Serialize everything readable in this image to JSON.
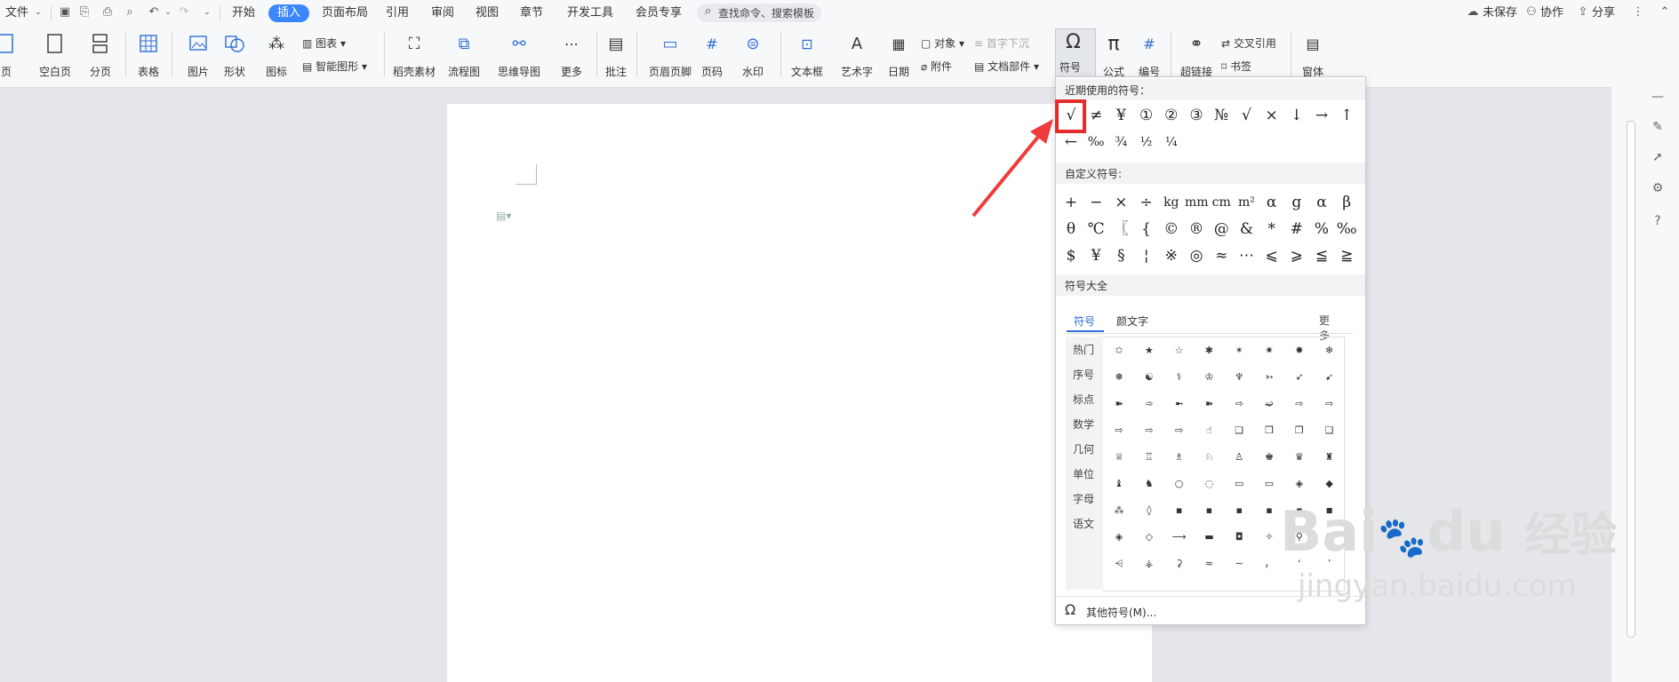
{
  "menubar": {
    "file": "文件",
    "tabs": [
      "开始",
      "插入",
      "页面布局",
      "引用",
      "审阅",
      "视图",
      "章节",
      "开发工具",
      "会员专享"
    ],
    "active_tab": "插入",
    "search_placeholder": "查找命令、搜索模板",
    "right": {
      "unsaved": "未保存",
      "collab": "协作",
      "share": "分享"
    }
  },
  "ribbon": {
    "buttons": [
      "页",
      "空白页",
      "分页",
      "表格",
      "图片",
      "形状",
      "图标",
      "稻壳素材",
      "流程图",
      "思维导图",
      "更多",
      "批注",
      "页眉页脚",
      "页码",
      "水印",
      "文本框",
      "艺术字",
      "日期",
      "符号",
      "公式",
      "编号",
      "超链接",
      "窗体"
    ],
    "small": {
      "chart": "图表",
      "smart": "智能图形",
      "object": "对象",
      "attachment": "附件",
      "dropcap": "首字下沉",
      "docpart": "文档部件",
      "crossref": "交叉引用",
      "bookmark": "书签"
    }
  },
  "symbol_panel": {
    "recent_title": "近期使用的符号：",
    "recent": [
      "√",
      "≠",
      "¥",
      "①",
      "②",
      "③",
      "№",
      "√",
      "×",
      "↓",
      "→",
      "↑",
      "←",
      "‰",
      "¾",
      "½",
      "¼"
    ],
    "custom_title": "自定义符号:",
    "custom": [
      "+",
      "−",
      "×",
      "÷",
      "kg",
      "mm",
      "cm",
      "m²",
      "α",
      "g",
      "α",
      "β",
      "θ",
      "℃",
      "〖",
      "{",
      "©",
      "®",
      "@",
      "&",
      "*",
      "#",
      "%",
      "‰",
      "$",
      "¥",
      "§",
      "¦",
      "※",
      "◎",
      "≈",
      "⋯",
      "⩽",
      "⩾",
      "≦",
      "≧"
    ],
    "all_title": "符号大全",
    "tab_symbols": "符号",
    "tab_emoticons": "颜文字",
    "more": "更多",
    "categories": [
      "热门",
      "序号",
      "标点",
      "数学",
      "几何",
      "单位",
      "字母",
      "语文"
    ],
    "glyphs": [
      "✩",
      "★",
      "☆",
      "✱",
      "✴",
      "✷",
      "✸",
      "❄",
      "❅",
      "☯",
      "⚕",
      "♔",
      "♆",
      "➳",
      "➶",
      "➹",
      "➽",
      "➾",
      "➼",
      "➽",
      "⇨",
      "➫",
      "⇨",
      "⇨",
      "⇨",
      "⇨",
      "⇨",
      "☝",
      "❑",
      "❒",
      "❐",
      "❏",
      "♕",
      "♖",
      "♗",
      "♘",
      "♙",
      "♚",
      "♛",
      "♜",
      "♝",
      "♞",
      "○",
      "◌",
      "▭",
      "▭",
      "◈",
      "◆",
      "⁂",
      "◊",
      "▪",
      "▪",
      "▪",
      "▪",
      "▪",
      "◾",
      "◈",
      "◇",
      "⟶",
      "▬",
      "◘",
      "✧",
      "⚲",
      "⚚",
      "⩤",
      "⚶",
      "⚳",
      "≈",
      "∼",
      "，",
      "ʻ",
      "ʼ"
    ],
    "other_symbols": "其他符号(M)..."
  },
  "watermark": {
    "brand": "Bai",
    "paw": "du",
    "text": "经验",
    "url": "jingyan.baidu.com"
  },
  "colors": {
    "accent": "#3a86ff",
    "highlight": "#e52b2b",
    "arrow": "#f03c3c"
  }
}
